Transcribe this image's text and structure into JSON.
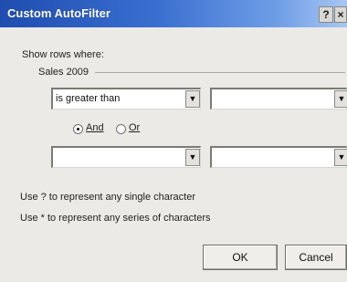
{
  "window": {
    "title": "Custom AutoFilter",
    "help_glyph": "?",
    "close_glyph": "×"
  },
  "criteria": {
    "show_rows_label": "Show rows where:",
    "field_name": "Sales 2009",
    "row1": {
      "operator": "is greater than",
      "value": ""
    },
    "logic": {
      "and_label": "And",
      "or_label": "Or",
      "selected": "And"
    },
    "row2": {
      "operator": "",
      "value": ""
    },
    "dropdown_glyph": "▼"
  },
  "hints": {
    "single_char": "Use ? to represent any single character",
    "series_chars": "Use * to represent any series of characters"
  },
  "buttons": {
    "ok": "OK",
    "cancel": "Cancel"
  }
}
